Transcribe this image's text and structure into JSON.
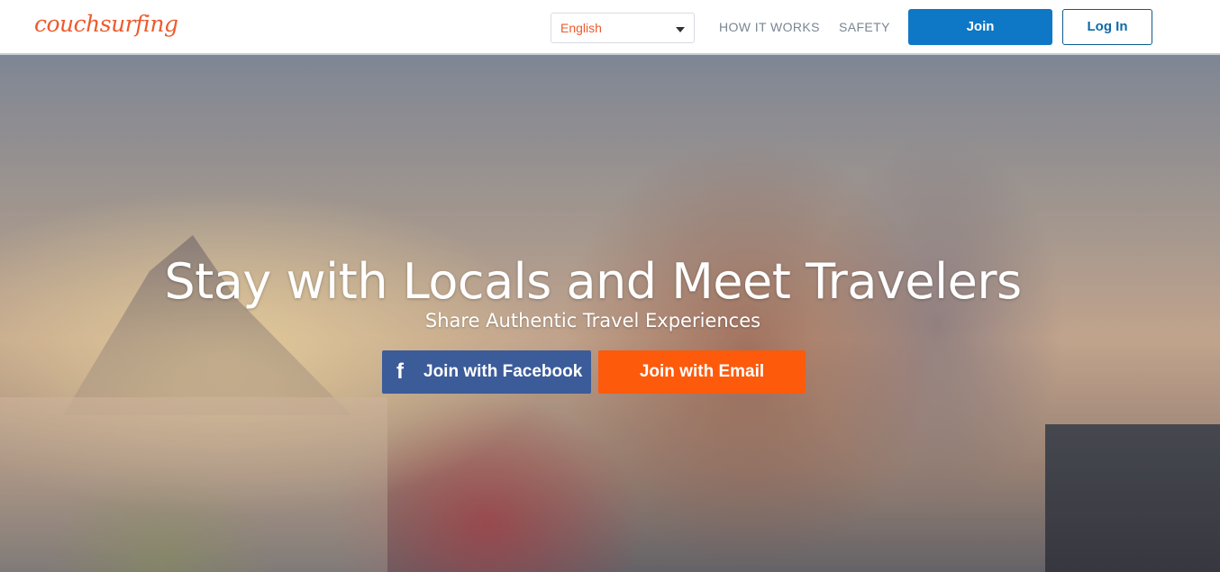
{
  "header": {
    "logo_text": "couchsurfing",
    "language": {
      "selected": "English"
    },
    "nav": {
      "how_it_works": "HOW IT WORKS",
      "safety": "SAFETY"
    },
    "join_label": "Join",
    "login_label": "Log In"
  },
  "hero": {
    "title": "Stay with Locals and Meet Travelers",
    "subtitle": "Share Authentic Travel Experiences",
    "facebook_icon": "f",
    "facebook_label": "Join with Facebook",
    "email_label": "Join with Email"
  },
  "colors": {
    "brand_orange": "#ed5b2d",
    "join_blue": "#0e78c6",
    "facebook_blue": "#3b5b99",
    "email_orange": "#fd5a0c"
  }
}
